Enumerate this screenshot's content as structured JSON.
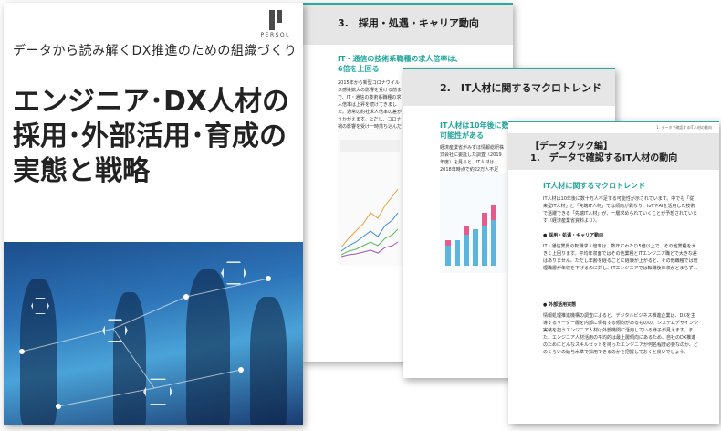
{
  "cover": {
    "subtitle": "データから読み解くDX推進のための組織づくり",
    "title_line1": "エンジニア･DX人材の",
    "title_line2": "採用･外部活用･育成の",
    "title_line3": "実態と戦略",
    "logo_text": "PERSOL"
  },
  "page3": {
    "running_header": "3. 採用・処遇・キャリア動向",
    "title": "3.　採用・処遇・キャリア動向",
    "subhead_line1": "IT・通信の技術系職種の求人倍率は、",
    "subhead_line2": "6倍を上回る",
    "body": "2015年から新型コロナウイルス感染拡大の影響を受ける前まで、IT・通信の技術系職種の求人倍率は上昇を続けてきました。通常の約社求人倍率の差がうかがえます。ただし、コロナ禍の影響を受け一時落ち込んだものの、2021年からは再び上昇しています。DXニーズの増加などに伴い、さらに上昇しています。"
  },
  "page2": {
    "running_header": "2. IT人材に関するマクロトレンド",
    "title": "2.　IT人材に関するマクロトレンド",
    "subhead_line1": "IT人材は10年後に数十万人不足する",
    "subhead_line2": "可能性がある",
    "body": "経済産業省がみずほ情報総研株式会社に委託した調査（2019年度）を見ると、IT人材は2018年時点で約22万人不足し、2030年にはさらに16万人、多ければ79万人に拡大すると予測されています。"
  },
  "page1": {
    "running_header": "1. データで確認するIT人材の動向",
    "title_line1": "【データブック編】",
    "title_line2": "1.　データで確認するIT人材の動向",
    "subhead": "IT人材に関するマクロトレンド",
    "body1": "IT人材は10年後に数十万人不足する可能性が示されています。中でも「従来型IT人材」と「先端IT人材」では傾向が異なり、IoTやAIを活用した技術で活躍できる「先端IT人材」が、一層求められていくことが予想されています（経済産業省資料より）。",
    "bullet1": "● 採用・処遇・キャリア動向",
    "body2": "IT・通信業界の転職求人倍率は、数年にわたり5倍以上で、その他業種を大きく上回ります。平均年収面ではその他業種とITエンジニア職とで大きな差はありません。ただし年齢を経るごとに経験が上がると、その他職種では管理職層が年収を下げるのに対し、ITエンジニアでは転職後年収がとまらず…",
    "bullet2": "● 外部活用実態",
    "body3": "情報処理推進機構の調査によると、デジタルビジネス推進企業は、DXを主導するリーダー層を内部に保有する傾向があるものの、システムデザインや実装を担うエンジニア人材は外部機関に活用している様子が見えます。また、エンジニア人材活用の平均的は最上層傾向にあるため、自社のDX推進のためにどんなスキルセットを持ったエンジニアが何名程度必要なのか、どのくらいの給与水準で採用できるのかを把握しておくと良いでしょう。"
  }
}
